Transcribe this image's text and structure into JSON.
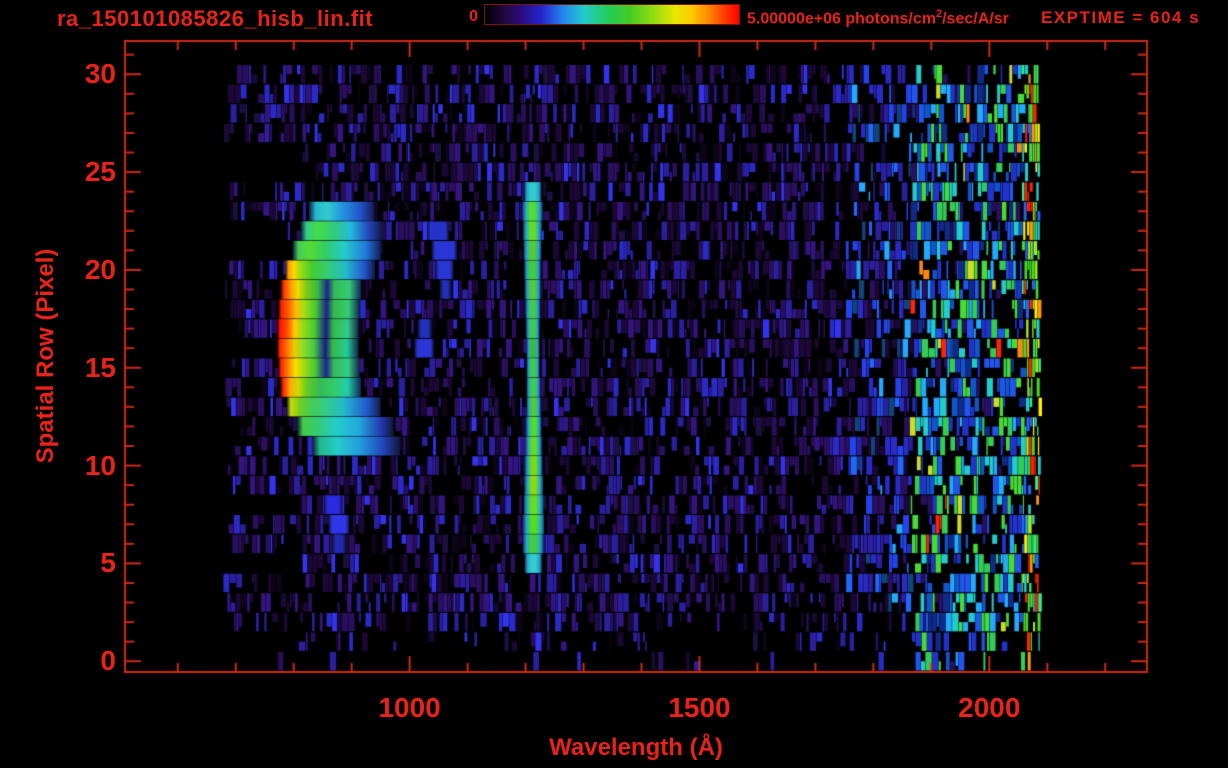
{
  "header": {
    "title": "ra_150101085826_hisb_lin.fit",
    "exptime_label": "EXPTIME = 604 s",
    "colorbar": {
      "min_label": "0",
      "max_label_prefix": "5.00000e+06 photons/cm",
      "max_label_sup": "2",
      "max_label_suffix": "/sec/A/sr",
      "gradient": [
        [
          "#000000",
          0
        ],
        [
          "#20063a",
          7
        ],
        [
          "#2b0a72",
          13
        ],
        [
          "#2422cc",
          22
        ],
        [
          "#2288ee",
          31
        ],
        [
          "#22cccc",
          39
        ],
        [
          "#22cc55",
          49
        ],
        [
          "#44cc22",
          57
        ],
        [
          "#99dd11",
          67
        ],
        [
          "#e8e800",
          75
        ],
        [
          "#ffcc00",
          81
        ],
        [
          "#ff8800",
          88
        ],
        [
          "#ff3300",
          95
        ],
        [
          "#ff0000",
          100
        ]
      ]
    }
  },
  "axes": {
    "x": {
      "label": "Wavelength (Å)",
      "min": 509,
      "max": 2272,
      "major_ticks": [
        1000,
        1500,
        2000
      ],
      "minor": {
        "start": 600,
        "end": 2200,
        "step": 100
      }
    },
    "y": {
      "label": "Spatial Row (Pixel)",
      "min": -0.55,
      "max": 31.7,
      "major_ticks": [
        0,
        5,
        10,
        15,
        20,
        25,
        30
      ],
      "minor": {
        "start": 0,
        "end": 31,
        "step": 1
      }
    }
  },
  "colors": {
    "frame": "#cf2a12",
    "text": "#e8231a",
    "background": "#000000"
  },
  "chart_data": {
    "type": "heatmap",
    "title": "ra_150101085826_hisb_lin.fit",
    "xlabel": "Wavelength (Å)",
    "ylabel": "Spatial Row (Pixel)",
    "xlim": [
      509,
      2272
    ],
    "ylim": [
      -0.55,
      31.7
    ],
    "colorbar_range": [
      0,
      5000000
    ],
    "colorbar_units": "photons/cm2/sec/A/sr",
    "exposure_label": "EXPTIME = 604 s",
    "data_extent": {
      "wavelength": [
        678,
        2085
      ],
      "rows": [
        0,
        30
      ]
    },
    "noise": {
      "seed": 1234567,
      "x_start": 678,
      "x_end": 2085,
      "zones": {
        "mid_start": 1748,
        "right_start": 1862,
        "edge_start": 2055
      },
      "row_density": {
        "0": 0.08,
        "1": 0.3,
        "2": 0.78,
        "29": 0.88,
        "30": 0.82,
        "default": 0.93
      },
      "palettes": {
        "base": [
          [
            "#000000",
            30
          ],
          [
            "#0d0418",
            8
          ],
          [
            "#1b0836",
            16
          ],
          [
            "#290f5e",
            14
          ],
          [
            "#34157f",
            10
          ],
          [
            "#2a1f9e",
            10
          ],
          [
            "#2a2ac8",
            6
          ],
          [
            "#3333ee",
            3
          ],
          [
            "#1c1042",
            3
          ]
        ],
        "mid": [
          [
            "#000000",
            22
          ],
          [
            "#1b0836",
            10
          ],
          [
            "#290f5e",
            12
          ],
          [
            "#2a1f9e",
            12
          ],
          [
            "#2a2ac8",
            12
          ],
          [
            "#2244ee",
            10
          ],
          [
            "#2266ff",
            5
          ],
          [
            "#22aaff",
            3
          ],
          [
            "#11447a",
            4
          ]
        ],
        "right": [
          [
            "#000000",
            16
          ],
          [
            "#2233cc",
            12
          ],
          [
            "#2255ee",
            10
          ],
          [
            "#22aaff",
            7
          ],
          [
            "#22cccc",
            9
          ],
          [
            "#33cc55",
            9
          ],
          [
            "#44dd33",
            7
          ],
          [
            "#1155cc",
            8
          ],
          [
            "#112a88",
            6
          ],
          [
            "#ccdd22",
            1.2
          ],
          [
            "#ff8811",
            0.6
          ],
          [
            "#ff2211",
            0.9
          ],
          [
            "#2a0f5e",
            4
          ]
        ],
        "edge": [
          [
            "#44dd22",
            16
          ],
          [
            "#aaee11",
            8
          ],
          [
            "#ffee00",
            6
          ],
          [
            "#ff9900",
            4
          ],
          [
            "#ff2200",
            6
          ],
          [
            "#22cccc",
            10
          ],
          [
            "#2266ff",
            8
          ],
          [
            "#33ee88",
            8
          ],
          [
            "#000000",
            6
          ]
        ]
      }
    },
    "features": {
      "crescent_arc": {
        "description": "bright curved emission arc, red-orange core near 780 Å on rows 14-19, opening toward longer wavelengths",
        "rows": [
          {
            "row": 23,
            "stops": [
              [
                826,
                "#0e1638"
              ],
              [
                838,
                "#22bbcc"
              ],
              [
                858,
                "#33cccc"
              ],
              [
                882,
                "#2299dd"
              ],
              [
                915,
                "#2255cc"
              ],
              [
                938,
                "#13205a"
              ]
            ]
          },
          {
            "row": 22,
            "stops": [
              [
                812,
                "#0e1638"
              ],
              [
                822,
                "#33cc88"
              ],
              [
                842,
                "#44dd44"
              ],
              [
                868,
                "#33cc77"
              ],
              [
                898,
                "#22bbdd"
              ],
              [
                930,
                "#2244bb"
              ],
              [
                952,
                "#121a48"
              ]
            ]
          },
          {
            "row": 21,
            "stops": [
              [
                798,
                "#0e1638"
              ],
              [
                808,
                "#44cc55"
              ],
              [
                828,
                "#55dd33"
              ],
              [
                855,
                "#33cc66"
              ],
              [
                888,
                "#22cccc"
              ],
              [
                925,
                "#2277dd"
              ],
              [
                950,
                "#13205a"
              ]
            ]
          },
          {
            "row": 20,
            "stops": [
              [
                786,
                "#3a1a00"
              ],
              [
                791,
                "#ff9900"
              ],
              [
                800,
                "#ffd700"
              ],
              [
                812,
                "#99dd11"
              ],
              [
                832,
                "#44cc33"
              ],
              [
                860,
                "#33cc77"
              ],
              [
                890,
                "#22bbcc"
              ],
              [
                922,
                "#2255cc"
              ],
              [
                940,
                "#121c4e"
              ]
            ]
          },
          {
            "row": 19,
            "stops": [
              [
                778,
                "#4a0000"
              ],
              [
                783,
                "#ff3300"
              ],
              [
                795,
                "#ff9900"
              ],
              [
                807,
                "#eedd00"
              ],
              [
                820,
                "#88cc11"
              ],
              [
                842,
                "#33bb44"
              ],
              [
                858,
                "#1d2490"
              ],
              [
                870,
                "#33bb55"
              ],
              [
                896,
                "#33cc77"
              ],
              [
                916,
                "#13255c"
              ]
            ]
          },
          {
            "row": 18,
            "stops": [
              [
                774,
                "#4a0000"
              ],
              [
                779,
                "#ff2200"
              ],
              [
                792,
                "#ff6600"
              ],
              [
                804,
                "#ffbb00"
              ],
              [
                817,
                "#aadd11"
              ],
              [
                838,
                "#44cc33"
              ],
              [
                857,
                "#1d2090"
              ],
              [
                869,
                "#33bb44"
              ],
              [
                894,
                "#33cc77"
              ],
              [
                914,
                "#12234f"
              ]
            ]
          },
          {
            "row": 17,
            "stops": [
              [
                772,
                "#3c0000"
              ],
              [
                776,
                "#ff1100"
              ],
              [
                790,
                "#ff5500"
              ],
              [
                802,
                "#ffcc00"
              ],
              [
                815,
                "#99dd11"
              ],
              [
                836,
                "#44cc33"
              ],
              [
                856,
                "#1a1a88"
              ],
              [
                868,
                "#33bb44"
              ],
              [
                893,
                "#33cc88"
              ],
              [
                912,
                "#122247"
              ]
            ]
          },
          {
            "row": 16,
            "stops": [
              [
                772,
                "#3c0000"
              ],
              [
                776,
                "#ff2200"
              ],
              [
                789,
                "#ff7700"
              ],
              [
                801,
                "#eecc00"
              ],
              [
                814,
                "#99dd22"
              ],
              [
                835,
                "#44cc44"
              ],
              [
                855,
                "#1a1a88"
              ],
              [
                867,
                "#33bb44"
              ],
              [
                892,
                "#22cc99"
              ],
              [
                912,
                "#112145"
              ]
            ]
          },
          {
            "row": 15,
            "stops": [
              [
                774,
                "#4a0000"
              ],
              [
                778,
                "#ff2200"
              ],
              [
                791,
                "#ff8800"
              ],
              [
                803,
                "#ffdd00"
              ],
              [
                816,
                "#aadd11"
              ],
              [
                837,
                "#44cc33"
              ],
              [
                856,
                "#202095"
              ],
              [
                869,
                "#33bb55"
              ],
              [
                894,
                "#33cc88"
              ],
              [
                914,
                "#121f45"
              ]
            ]
          },
          {
            "row": 14,
            "stops": [
              [
                777,
                "#3a0000"
              ],
              [
                782,
                "#ff2200"
              ],
              [
                794,
                "#ffaa00"
              ],
              [
                808,
                "#ccdd00"
              ],
              [
                822,
                "#66cc22"
              ],
              [
                845,
                "#33bb55"
              ],
              [
                868,
                "#33cc66"
              ],
              [
                893,
                "#22ccaa"
              ],
              [
                916,
                "#13265a"
              ]
            ]
          },
          {
            "row": 13,
            "stops": [
              [
                788,
                "#0e1434"
              ],
              [
                795,
                "#ccdd00"
              ],
              [
                810,
                "#77cc22"
              ],
              [
                830,
                "#44cc55"
              ],
              [
                856,
                "#33cc88"
              ],
              [
                886,
                "#22bbcc"
              ],
              [
                928,
                "#2255cc"
              ],
              [
                950,
                "#121d48"
              ]
            ]
          },
          {
            "row": 12,
            "stops": [
              [
                806,
                "#0e1434"
              ],
              [
                816,
                "#44cc44"
              ],
              [
                842,
                "#33cc77"
              ],
              [
                874,
                "#22cccc"
              ],
              [
                912,
                "#22aadd"
              ],
              [
                952,
                "#2236ad"
              ],
              [
                972,
                "#111838"
              ]
            ]
          },
          {
            "row": 11,
            "stops": [
              [
                832,
                "#0e1434"
              ],
              [
                845,
                "#22bb88"
              ],
              [
                876,
                "#22cccc"
              ],
              [
                916,
                "#2299dd"
              ],
              [
                955,
                "#2244bb"
              ],
              [
                984,
                "#111634"
              ]
            ]
          }
        ]
      },
      "blue_patches": [
        {
          "row": 22,
          "x0": 1030,
          "x1": 1068,
          "color": "#2531c8"
        },
        {
          "row": 21,
          "x0": 1038,
          "x1": 1082,
          "color": "#2a35d5"
        },
        {
          "row": 20,
          "x0": 1044,
          "x1": 1076,
          "color": "#2a35d5"
        },
        {
          "row": 19,
          "x0": 1052,
          "x1": 1072,
          "color": "#2230b8"
        },
        {
          "row": 17,
          "x0": 1014,
          "x1": 1038,
          "color": "#2230c0"
        },
        {
          "row": 16,
          "x0": 1008,
          "x1": 1042,
          "color": "#2a35d5"
        },
        {
          "row": 8,
          "x0": 852,
          "x1": 884,
          "color": "#2a2ade"
        },
        {
          "row": 7,
          "x0": 860,
          "x1": 896,
          "color": "#2f35e8"
        },
        {
          "row": 6,
          "x0": 866,
          "x1": 890,
          "color": "#2228b0"
        }
      ],
      "emission_line": {
        "description": "narrow vertical emission line near 1213 Å spanning rows 5-24",
        "x_center": 1213,
        "edge": "#22aacc",
        "outer": "#123f7a",
        "rows": [
          {
            "row": 24,
            "x0": 1198,
            "x1": 1227,
            "core": "#33cccc"
          },
          {
            "row": 23,
            "x0": 1195,
            "x1": 1229,
            "core": "#55dd33"
          },
          {
            "row": 22,
            "x0": 1196,
            "x1": 1228,
            "core": "#66dd22"
          },
          {
            "row": 21,
            "x0": 1197,
            "x1": 1227,
            "core": "#55cc33"
          },
          {
            "row": 20,
            "x0": 1198,
            "x1": 1226,
            "core": "#44cc33"
          },
          {
            "row": 19,
            "x0": 1199,
            "x1": 1226,
            "core": "#55cc33"
          },
          {
            "row": 18,
            "x0": 1200,
            "x1": 1225,
            "core": "#44cc44"
          },
          {
            "row": 17,
            "x0": 1201,
            "x1": 1224,
            "core": "#44cc44"
          },
          {
            "row": 16,
            "x0": 1202,
            "x1": 1224,
            "core": "#3fbb33"
          },
          {
            "row": 15,
            "x0": 1202,
            "x1": 1224,
            "core": "#44cc44"
          },
          {
            "row": 14,
            "x0": 1202,
            "x1": 1225,
            "core": "#44cc44"
          },
          {
            "row": 13,
            "x0": 1202,
            "x1": 1226,
            "core": "#55cc33"
          },
          {
            "row": 12,
            "x0": 1201,
            "x1": 1227,
            "core": "#55dd22"
          },
          {
            "row": 11,
            "x0": 1200,
            "x1": 1228,
            "core": "#66dd22"
          },
          {
            "row": 10,
            "x0": 1199,
            "x1": 1229,
            "core": "#77dd11"
          },
          {
            "row": 9,
            "x0": 1198,
            "x1": 1230,
            "core": "#88dd11"
          },
          {
            "row": 8,
            "x0": 1197,
            "x1": 1231,
            "core": "#66dd22"
          },
          {
            "row": 7,
            "x0": 1196,
            "x1": 1232,
            "core": "#55dd22"
          },
          {
            "row": 6,
            "x0": 1196,
            "x1": 1231,
            "core": "#44cc44"
          },
          {
            "row": 5,
            "x0": 1199,
            "x1": 1228,
            "core": "#33cccc"
          }
        ]
      },
      "right_edge_band": {
        "description": "dense noisy band of blue/cyan/green columns with sporadic yellow-red pixels",
        "x_range": [
          1862,
          2085
        ],
        "row_range": [
          0,
          30
        ]
      }
    }
  }
}
